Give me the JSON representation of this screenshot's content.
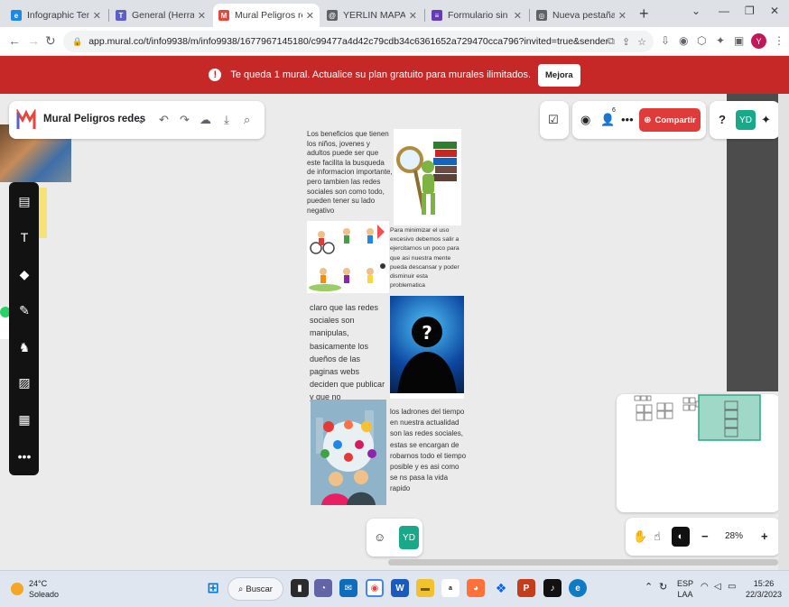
{
  "browser": {
    "tabs": [
      {
        "label": "Infographic Template",
        "favicon": "e",
        "color": "#1e88e5"
      },
      {
        "label": "General (Herramientas",
        "favicon": "T",
        "color": "#5b5fc7"
      },
      {
        "label": "Mural Peligros redes ·",
        "favicon": "M",
        "color": "#e8453c"
      },
      {
        "label": "YERLIN MAPA CONCE",
        "favicon": "@",
        "color": "#5f6368"
      },
      {
        "label": "Formulario sin título ·",
        "favicon": "≡",
        "color": "#673ab7"
      },
      {
        "label": "Nueva pestaña",
        "favicon": "◎",
        "color": "#5f6368"
      }
    ],
    "url": "app.mural.co/t/info9938/m/info9938/1677967145180/c99477a4d42c79cdb34c6361652a729470cca796?invited=true&sender=u2ced599f9115...",
    "profile_initial": "Y"
  },
  "banner": {
    "message": "Te queda 1 mural. Actualice su plan gratuito para murales ilimitados.",
    "upgrade_label": "Mejora"
  },
  "mural": {
    "title": "Mural Peligros redes",
    "share_label": "Compartir",
    "participants_count": "6",
    "user_initials": "YD",
    "zoom_level": "28%",
    "texts": {
      "intro": "Los beneficios que tienen los niños, jovenes y adultos puede ser que este facilita la busqueda de informacion importante, pero tambien las redes sociales son como todo, pueden tener su lado negativo",
      "minimize": "Para minimizar el uso excesivo debemos salir a ejercitarnos un poco para que asi nuestra mente pueda descansar y poder disminuir esta problematica",
      "manipulate": "claro que las redes sociales son manipulas, basicamente los dueños de las paginas webs deciden que publicar y que no",
      "thieves": "los ladrones del tiempo en nuestra actualidad son las redes sociales, estas se encargan de robarnos todo el tiempo posible y es asi como se ns pasa la vida rapido"
    }
  },
  "taskbar": {
    "temperature": "24°C",
    "weather": "Soleado",
    "search_label": "Buscar",
    "language": "ESP",
    "layout": "LAA",
    "time": "15:26",
    "date": "22/3/2023"
  }
}
